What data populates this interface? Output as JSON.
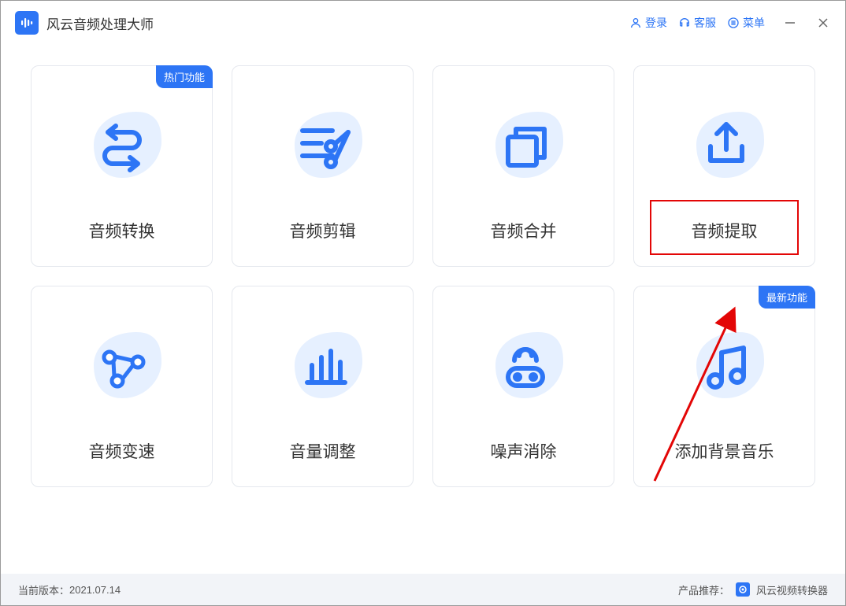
{
  "app": {
    "title": "风云音频处理大师"
  },
  "titlebar": {
    "login": "登录",
    "support": "客服",
    "menu": "菜单"
  },
  "badges": {
    "hot": "热门功能",
    "new": "最新功能"
  },
  "cards": [
    {
      "label": "音频转换"
    },
    {
      "label": "音频剪辑"
    },
    {
      "label": "音频合并"
    },
    {
      "label": "音频提取"
    },
    {
      "label": "音频变速"
    },
    {
      "label": "音量调整"
    },
    {
      "label": "噪声消除"
    },
    {
      "label": "添加背景音乐"
    }
  ],
  "footer": {
    "version_label": "当前版本：",
    "version": "2021.07.14",
    "recommend_label": "产品推荐：",
    "recommend_product": "风云视频转换器"
  }
}
